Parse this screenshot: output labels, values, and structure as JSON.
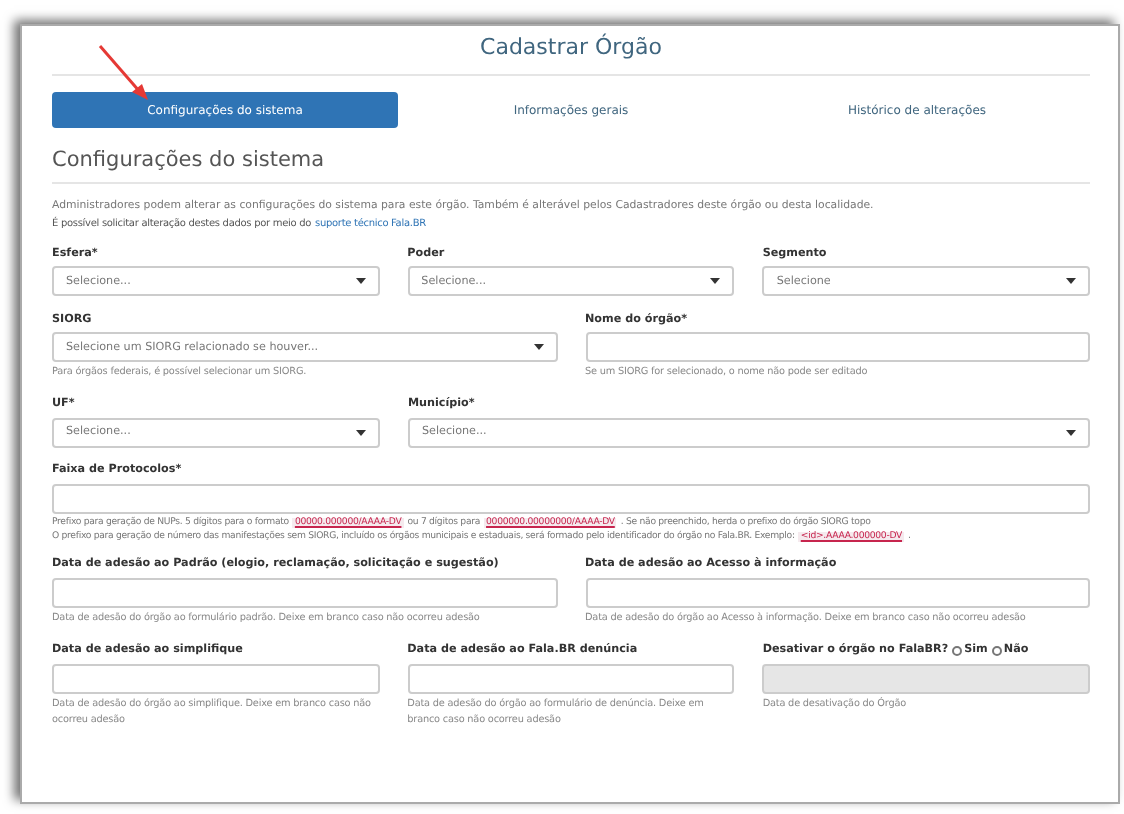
{
  "title": "Cadastrar Órgão",
  "tabs": [
    {
      "label": "Configurações do sistema",
      "selected": true
    },
    {
      "label": "Informações gerais",
      "selected": false
    },
    {
      "label": "Histórico de alterações",
      "selected": false
    }
  ],
  "section": {
    "heading": "Configurações do sistema",
    "description": "Administradores podem alterar as configurações do sistema para este órgão. Também é alterável pelos Cadastradores deste órgão ou desta localidade.",
    "request_text": "É possível solicitar alteração destes dados por meio do",
    "request_link": "suporte técnico Fala.BR"
  },
  "rows": [
    {
      "fields": [
        {
          "kind": "select",
          "label": "Esfera*",
          "placeholder": "Selecione..."
        },
        {
          "kind": "select",
          "label": "Poder",
          "placeholder": "Selecione..."
        },
        {
          "kind": "select",
          "label": "Segmento",
          "placeholder": "Selecione"
        }
      ]
    },
    {
      "fields": [
        {
          "kind": "select",
          "label": "SIORG",
          "placeholder": "Selecione um SIORG relacionado se houver...",
          "helper": "Para órgãos federais, é possível selecionar um SIORG."
        },
        {
          "kind": "text",
          "label": "Nome do órgão*",
          "helper": "Se um SIORG for selecionado, o nome não pode ser editado"
        }
      ]
    },
    {
      "fields": [
        {
          "kind": "select",
          "label": "UF*",
          "placeholder": "Selecione..."
        },
        {
          "kind": "select",
          "label": "Município*",
          "placeholder": "Selecione..."
        }
      ]
    },
    {
      "fields": [
        {
          "kind": "text",
          "label": "Faixa de Protocolos*",
          "helper_lines": [
            [
              {
                "kind": "text",
                "text": "Prefixo para geração de NUPs. 5 dígitos para o formato"
              },
              {
                "kind": "code",
                "text": "00000.000000/AAAA-DV"
              },
              {
                "kind": "text",
                "text": "ou 7 dígitos para"
              },
              {
                "kind": "code",
                "text": "0000000.00000000/AAAA-DV"
              },
              {
                "kind": "text",
                "text": ". Se não preenchido, herda o prefixo do órgão SIORG topo"
              }
            ],
            [
              {
                "kind": "text",
                "text": "O prefixo para geração de número das manifestações sem SIORG, incluído os órgãos municipais e estaduais, será formado pelo identificador do órgão no Fala.BR. Exemplo:"
              },
              {
                "kind": "code",
                "text": "<id>.AAAA.000000-DV"
              },
              {
                "kind": "text",
                "text": "."
              }
            ]
          ]
        }
      ]
    },
    {
      "fields": [
        {
          "kind": "text",
          "label": "Data de adesão ao Padrão (elogio, reclamação, solicitação e sugestão)",
          "helper": "Data de adesão do órgão ao formulário padrão. Deixe em branco caso não ocorreu adesão"
        },
        {
          "kind": "text",
          "label": "Data de adesão ao Acesso à informação",
          "helper": "Data de adesão do órgão ao Acesso à informação. Deixe em branco caso não ocorreu adesão"
        }
      ]
    },
    {
      "fields": [
        {
          "kind": "text",
          "label": "Data de adesão ao simplifique",
          "helper": "Data de adesão do órgão ao simplifique. Deixe em branco caso não ocorreu adesão"
        },
        {
          "kind": "text",
          "label": "Data de adesão ao Fala.BR denúncia",
          "helper": "Data de adesão do órgão ao formulário de denúncia. Deixe em branco caso não ocorreu adesão"
        },
        {
          "kind": "disabled",
          "label": "Desativar o órgão no FalaBR?",
          "radios": [
            {
              "label": "Sim",
              "selected": false
            },
            {
              "label": "Não",
              "selected": false
            }
          ],
          "helper": "Data de desativação do Órgão"
        }
      ]
    }
  ]
}
